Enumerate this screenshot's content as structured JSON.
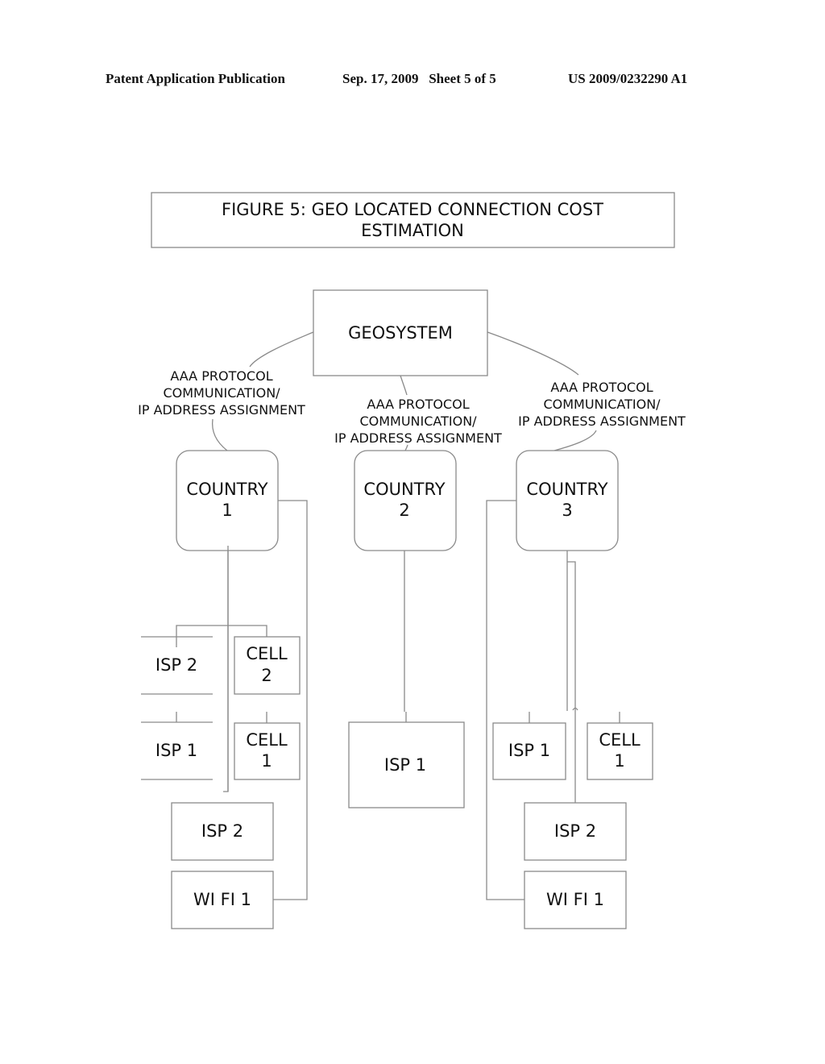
{
  "header": {
    "left": "Patent Application Publication",
    "middle": "Sep. 17, 2009   Sheet 5 of 5",
    "right": "US 2009/0232290 A1"
  },
  "figure": {
    "title_line1": "FIGURE 5: GEO LOCATED CONNECTION COST",
    "title_line2": "ESTIMATION"
  },
  "nodes": {
    "geosystem": "GEOSYSTEM",
    "country1": {
      "line1": "COUNTRY",
      "line2": "1"
    },
    "country2": {
      "line1": "COUNTRY",
      "line2": "2"
    },
    "country3": {
      "line1": "COUNTRY",
      "line2": "3"
    },
    "c1_isp2_top": "ISP 2",
    "c1_cell2": {
      "line1": "CELL",
      "line2": "2"
    },
    "c1_isp1": "ISP 1",
    "c1_cell1": {
      "line1": "CELL",
      "line2": "1"
    },
    "c1_isp2_bottom": "ISP 2",
    "c1_wifi1": "WI FI 1",
    "c2_isp1": "ISP 1",
    "c3_isp1": "ISP 1",
    "c3_cell1": {
      "line1": "CELL",
      "line2": "1"
    },
    "c3_isp2": "ISP 2",
    "c3_wifi1": "WI FI 1"
  },
  "edge_labels": {
    "left": {
      "line1": "AAA PROTOCOL",
      "line2": "COMMUNICATION/",
      "line3": "IP ADDRESS ASSIGNMENT"
    },
    "middle": {
      "line1": "AAA PROTOCOL",
      "line2": "COMMUNICATION/",
      "line3": "IP ADDRESS ASSIGNMENT"
    },
    "right": {
      "line1": "AAA PROTOCOL",
      "line2": "COMMUNICATION/",
      "line3": "IP ADDRESS ASSIGNMENT"
    }
  }
}
